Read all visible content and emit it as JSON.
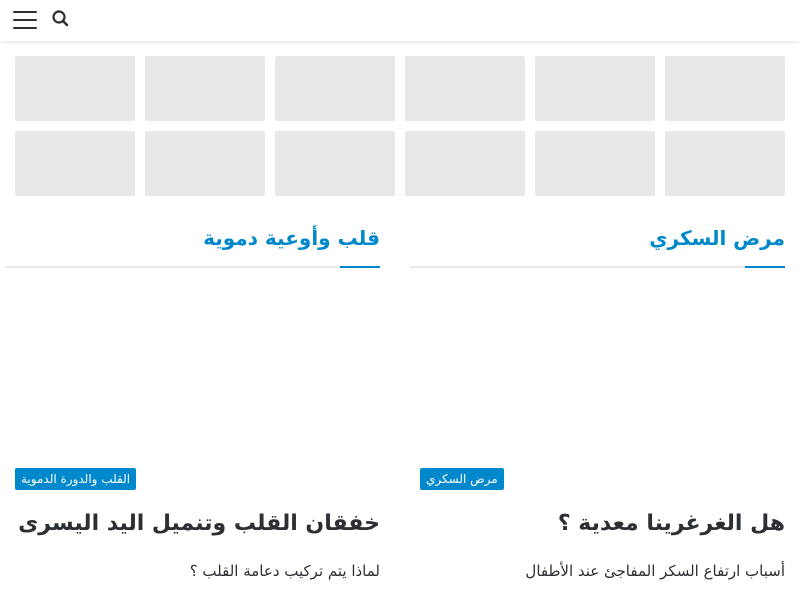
{
  "header": {
    "menu_icon": "hamburger-menu-icon",
    "search_icon": "search-icon"
  },
  "thumbnails": {
    "count": 12,
    "placeholder_color": "#e8e8e8"
  },
  "accent_color": "#0088cc",
  "sections": [
    {
      "title": "مرض السكري",
      "post": {
        "category": "مرض السكري",
        "title": "هل الغرغرينا معدية ؟",
        "excerpt": "أسباب ارتفاع السكر المفاجئ عند الأطفال"
      }
    },
    {
      "title": "قلب وأوعية دموية",
      "post": {
        "category": "القلب والدورة الدموية",
        "title": "خفقان القلب وتنميل اليد اليسرى",
        "excerpt": "لماذا يتم تركيب دعامة القلب ؟"
      }
    }
  ]
}
